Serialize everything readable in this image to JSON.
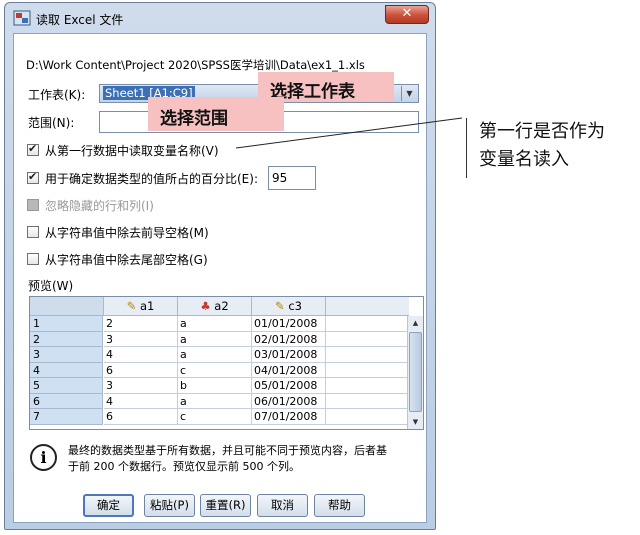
{
  "window": {
    "title": "读取 Excel 文件",
    "close_glyph": "✕"
  },
  "file_path": "D:\\Work Content\\Project 2020\\SPSS医学培训\\Data\\ex1_1.xls",
  "worksheet": {
    "label": "工作表(K):",
    "value": "Sheet1 [A1:C9]",
    "arrow": "▼"
  },
  "range": {
    "label": "范围(N):",
    "value": ""
  },
  "options": {
    "first_row_names": {
      "label": "从第一行数据中读取变量名称(V)",
      "checked": true
    },
    "percent_values": {
      "label": "用于确定数据类型的值所占的百分比(E):",
      "checked": true,
      "value": "95"
    },
    "ignore_hidden": {
      "label": "忽略隐藏的行和列(I)",
      "checked": false,
      "disabled": true
    },
    "strip_leading": {
      "label": "从字符串值中除去前导空格(M)",
      "checked": false
    },
    "strip_trailing": {
      "label": "从字符串值中除去尾部空格(G)",
      "checked": false
    }
  },
  "preview": {
    "label": "预览(W)",
    "columns": [
      "a1",
      "a2",
      "c3"
    ],
    "rows": [
      [
        "1",
        "2",
        "a",
        "01/01/2008"
      ],
      [
        "2",
        "3",
        "a",
        "02/01/2008"
      ],
      [
        "3",
        "4",
        "a",
        "03/01/2008"
      ],
      [
        "4",
        "6",
        "c",
        "04/01/2008"
      ],
      [
        "5",
        "3",
        "b",
        "05/01/2008"
      ],
      [
        "6",
        "4",
        "a",
        "06/01/2008"
      ],
      [
        "7",
        "6",
        "c",
        "07/01/2008"
      ]
    ]
  },
  "info": {
    "line1": "最终的数据类型基于所有数据，并且可能不同于预览内容，后者基",
    "line2": "于前 200 个数据行。预览仅显示前 500 个列。"
  },
  "buttons": {
    "ok": "确定",
    "paste": "粘贴(P)",
    "reset": "重置(R)",
    "cancel": "取消",
    "help": "帮助"
  },
  "annotations": {
    "select_sheet": "选择工作表",
    "select_range": "选择范围",
    "first_row_line1": "第一行是否作为",
    "first_row_line2": "变量名读入"
  }
}
